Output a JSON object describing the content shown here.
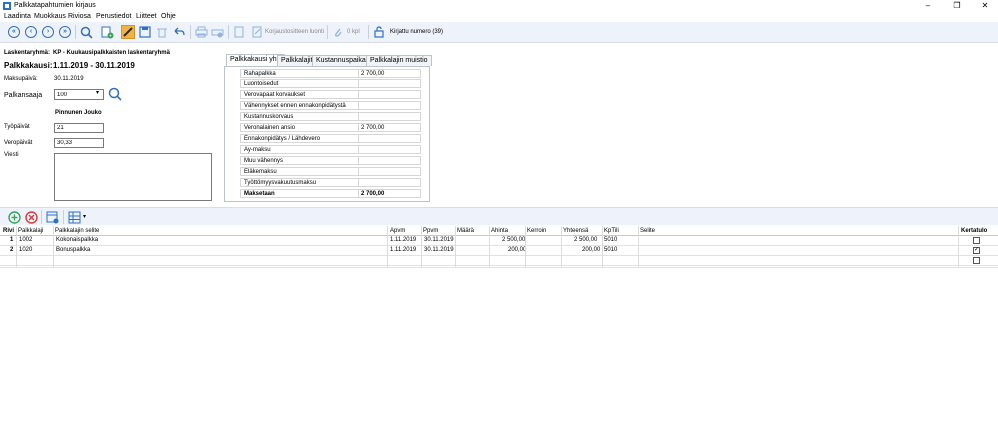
{
  "window": {
    "title": "Palkkatapahtumien kirjaus"
  },
  "menu": [
    "Laadinta",
    "Muokkaus",
    "Riviosa",
    "Perustiedot",
    "Liitteet",
    "Ohje"
  ],
  "toolbar": {
    "korjaustosite_label": "Korjaustositteen luonti",
    "attachments_label": "0 kpl",
    "status_label": "Kirjattu numero (39)"
  },
  "form": {
    "laskentaryhma_label": "Laskentaryhmä:",
    "laskentaryhma_value": "KP - Kuukausipalkkaisten laskentaryhmä",
    "palkkakausi_label": "Palkkakausi:",
    "palkkakausi_value": "1.11.2019 - 30.11.2019",
    "maksupaiva_label": "Maksupäivä:",
    "maksupaiva_value": "30.11.2019",
    "palkansaaja_label": "Palkansaaja",
    "palkansaaja_value": "100",
    "employee_name": "Pinnunen Jouko",
    "tyopaivat_label": "Työpäivät",
    "tyopaivat_value": "21",
    "veropaivat_label": "Veropäivät",
    "veropaivat_value": "30,33",
    "viesti_label": "Viesti",
    "viesti_value": ""
  },
  "tabs": [
    "Palkkakausi yht.",
    "Palkkalajit",
    "Kustannuspaikat",
    "Palkkalajin muistio"
  ],
  "summary": [
    {
      "label": "Rahapalkka",
      "value": "2 700,00"
    },
    {
      "label": "Luontoisedut",
      "value": ""
    },
    {
      "label": "Verovapaat korvaukset",
      "value": ""
    },
    {
      "label": "Vähennykset ennen ennakonpidätystä",
      "value": ""
    },
    {
      "label": "Kustannuskorvaus",
      "value": ""
    },
    {
      "label": "Veronalainen ansio",
      "value": "2 700,00"
    },
    {
      "label": "Ennakonpidätys / Lähdevero",
      "value": ""
    },
    {
      "label": "Ay-maksu",
      "value": ""
    },
    {
      "label": "Muu vähennys",
      "value": ""
    },
    {
      "label": "Eläkemaksu",
      "value": ""
    },
    {
      "label": "Työttömyysvakuutusmaksu",
      "value": ""
    },
    {
      "label": "Maksetaan",
      "value": "2 700,00"
    }
  ],
  "table": {
    "headers": {
      "rivi": "Rivi",
      "palkkalaji": "Palkkalaji",
      "selite": "Palkkalajin selite",
      "apvm": "Apvm",
      "ppvm": "Ppvm",
      "maara": "Määrä",
      "ahinta": "Ahinta",
      "kerroin": "Kerroin",
      "yhteensa": "Yhteensä",
      "kptili": "KpTili",
      "selite2": "Selite",
      "kertatulo": "Kertatulo"
    },
    "rows": [
      {
        "rivi": "1",
        "palkkalaji": "1002",
        "selite": "Kokonaispalkka",
        "apvm": "1.11.2019",
        "ppvm": "30.11.2019",
        "maara": "",
        "ahinta": "2 500,00",
        "kerroin": "",
        "yhteensa": "2 500,00",
        "kptili": "5010",
        "selite2": "",
        "kertatulo": false
      },
      {
        "rivi": "2",
        "palkkalaji": "1020",
        "selite": "Bonuspalkka",
        "apvm": "1.11.2019",
        "ppvm": "30.11.2019",
        "maara": "",
        "ahinta": "200,00",
        "kerroin": "",
        "yhteensa": "200,00",
        "kptili": "5010",
        "selite2": "",
        "kertatulo": true
      }
    ]
  },
  "colors": {
    "accent": "#2f6fc1",
    "toolbar_bg": "#eef3fb",
    "highlight": "#f3b340"
  }
}
